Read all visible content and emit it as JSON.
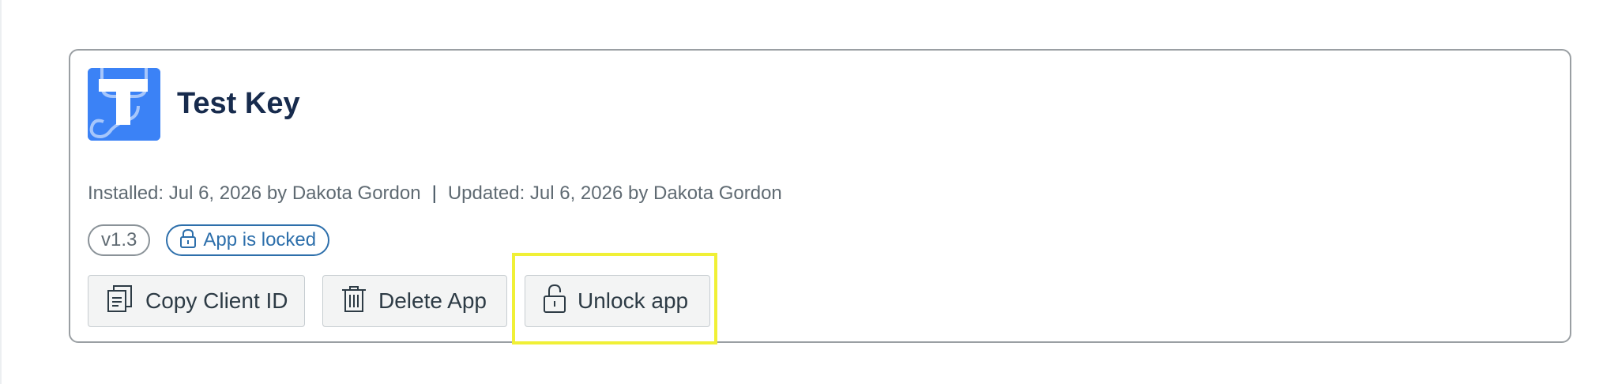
{
  "app": {
    "name": "Test Key",
    "icon": "app-logo-icon",
    "brand_color": "#3b82f6"
  },
  "meta": {
    "installed": "Installed: Jul 6, 2026 by Dakota Gordon",
    "separator": "|",
    "updated": "Updated: Jul 6, 2026 by Dakota Gordon"
  },
  "badges": {
    "version": "v1.3",
    "locked": {
      "label": "App is locked",
      "icon": "lock-icon",
      "color": "#2d6fab"
    }
  },
  "actions": {
    "copy_client_id": {
      "label": "Copy Client ID",
      "icon": "copy-icon"
    },
    "delete_app": {
      "label": "Delete App",
      "icon": "trash-icon"
    },
    "unlock_app": {
      "label": "Unlock app",
      "icon": "unlock-icon"
    }
  },
  "highlight_color": "#f0f036"
}
